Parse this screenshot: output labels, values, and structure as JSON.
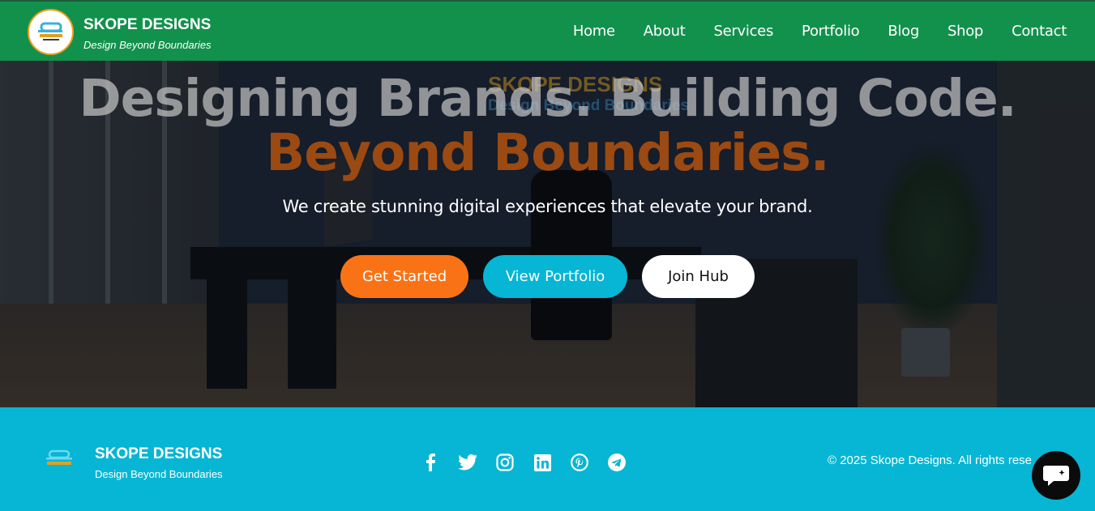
{
  "header": {
    "brand_name": "SKOPE DESIGNS",
    "brand_tagline": "Design Beyond Boundaries",
    "nav": [
      "Home",
      "About",
      "Services",
      "Portfolio",
      "Blog",
      "Shop",
      "Contact"
    ]
  },
  "hero": {
    "watermark_logo": "SKOPE DESIGNS",
    "watermark_tagline": "Design Beyond Boundaries",
    "headline_line1": "Designing Brands. Building Code.",
    "headline_line2": "Beyond Boundaries.",
    "subtitle": "We create stunning digital experiences that elevate your brand.",
    "buttons": {
      "get_started": "Get Started",
      "view_portfolio": "View Portfolio",
      "join_hub": "Join Hub"
    }
  },
  "footer": {
    "brand_name": "SKOPE DESIGNS",
    "brand_tagline": "Design Beyond Boundaries",
    "socials": [
      "facebook-icon",
      "twitter-icon",
      "instagram-icon",
      "linkedin-icon",
      "pinterest-icon",
      "telegram-icon"
    ],
    "copyright": "© 2025 Skope Designs. All rights rese"
  },
  "colors": {
    "header": "#12914c",
    "footer": "#06b6d4",
    "accent_orange": "#f97316",
    "accent_cyan": "#06b6d4",
    "headline2": "#9a4a12"
  },
  "chat": {
    "icon": "chat-icon"
  }
}
